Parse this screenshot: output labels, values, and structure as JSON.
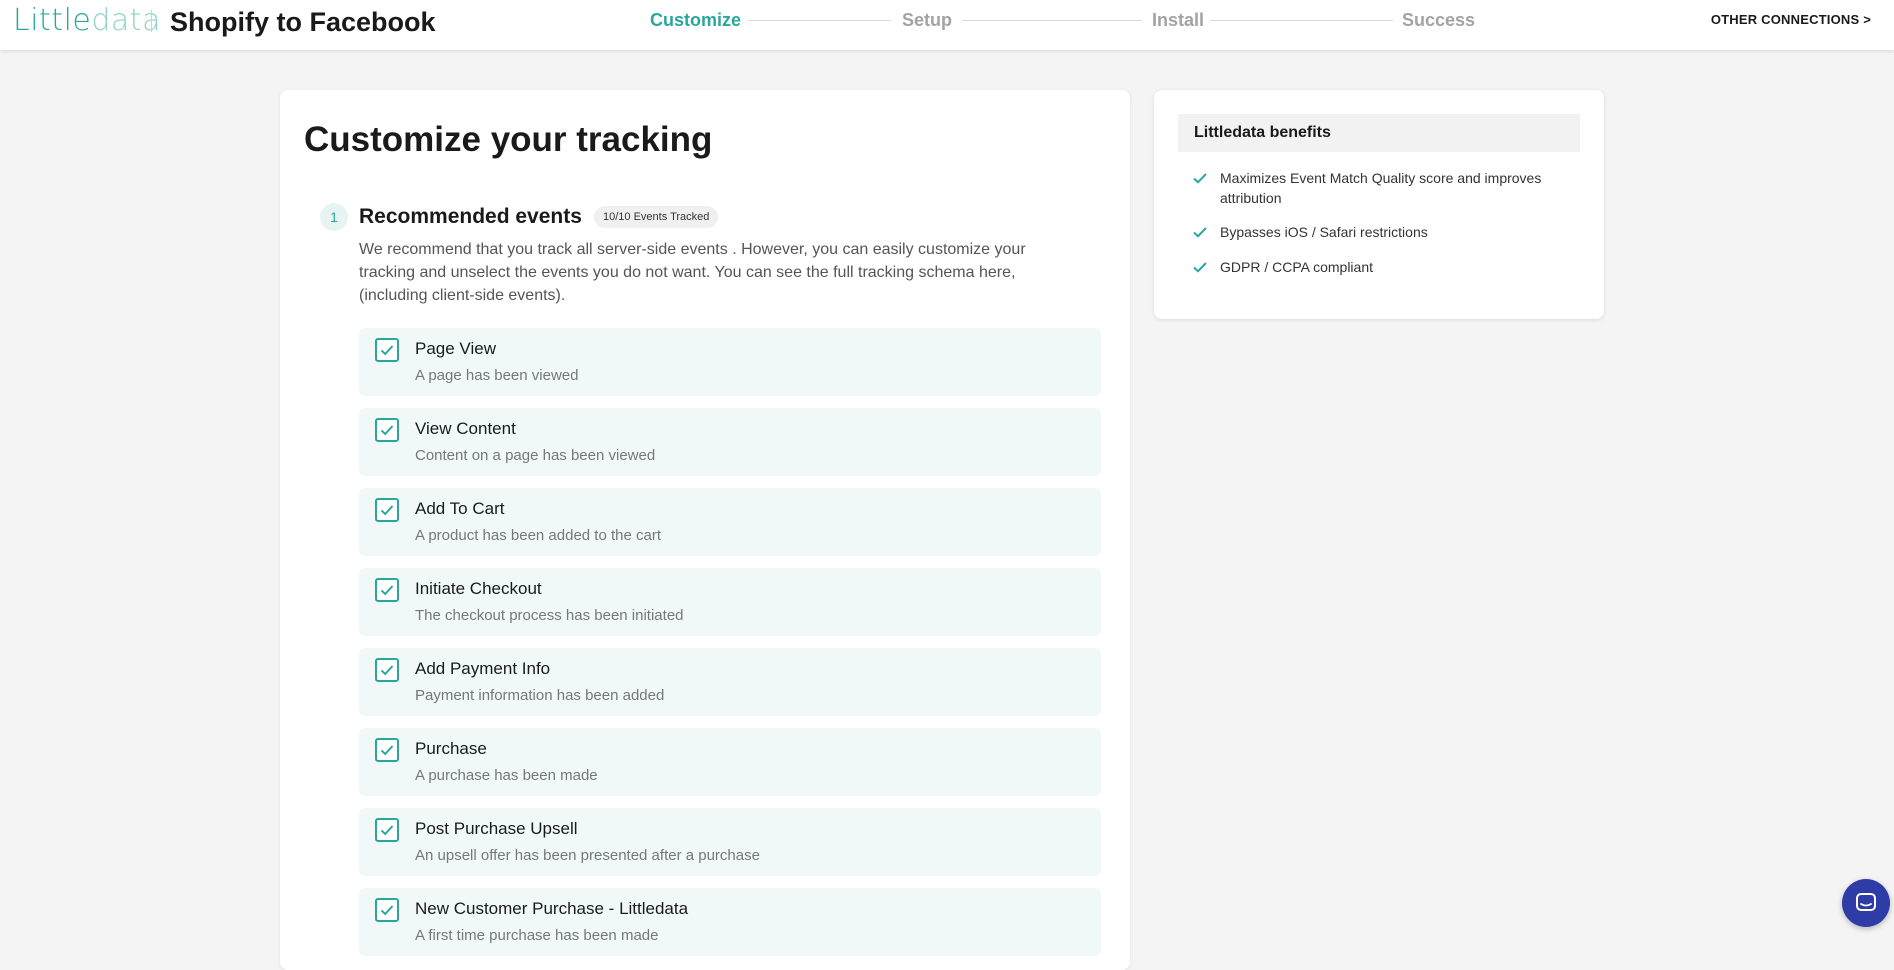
{
  "brand": {
    "logo_part1": "Little",
    "logo_part2": "data",
    "accent": "#2aa79b",
    "accent_light": "#8fd1c9"
  },
  "header": {
    "title": "Shopify to Facebook",
    "steps": [
      {
        "label": "Customize",
        "active": true
      },
      {
        "label": "Setup",
        "active": false
      },
      {
        "label": "Install",
        "active": false
      },
      {
        "label": "Success",
        "active": false
      }
    ],
    "other_connections": "OTHER CONNECTIONS >"
  },
  "main": {
    "title": "Customize your tracking",
    "section": {
      "number": "1",
      "title": "Recommended events",
      "badge": "10/10 Events Tracked",
      "description": "We recommend that you track all server-side events . However, you can easily customize your tracking and unselect the events you do not want. You can see the full tracking schema here, (including client-side events).",
      "events": [
        {
          "name": "Page View",
          "desc": "A page has been viewed",
          "checked": true
        },
        {
          "name": "View Content",
          "desc": "Content on a page has been viewed",
          "checked": true
        },
        {
          "name": "Add To Cart",
          "desc": "A product has been added to the cart",
          "checked": true
        },
        {
          "name": "Initiate Checkout",
          "desc": "The checkout process has been initiated",
          "checked": true
        },
        {
          "name": "Add Payment Info",
          "desc": "Payment information has been added",
          "checked": true
        },
        {
          "name": "Purchase",
          "desc": "A purchase has been made",
          "checked": true
        },
        {
          "name": "Post Purchase Upsell",
          "desc": "An upsell offer has been presented after a purchase",
          "checked": true
        },
        {
          "name": "New Customer Purchase - Littledata",
          "desc": "A first time purchase has been made",
          "checked": true
        }
      ]
    }
  },
  "benefits": {
    "title": "Littledata benefits",
    "items": [
      {
        "text": "Maximizes Event Match Quality score and improves attribution"
      },
      {
        "text": "Bypasses iOS / Safari restrictions"
      },
      {
        "text": "GDPR / CCPA compliant"
      }
    ]
  },
  "chat": {
    "icon": "chat-icon"
  }
}
